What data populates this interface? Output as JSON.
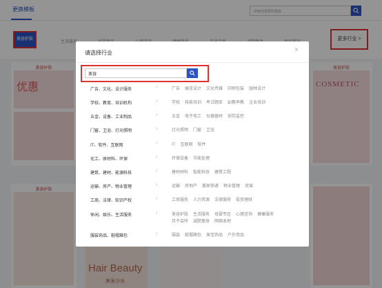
{
  "background": {
    "top_tab": "更换模板",
    "search_placeholder": "搜索您需要的模板",
    "active_category": "美容护肤",
    "ghost_categories": [
      "生活服务",
      "母婴专区",
      "心理咨询",
      "健康服务",
      "月子会所",
      "减肥瘦身",
      "医疗美容"
    ],
    "more_label": "更多行业 >",
    "card_labels": [
      "美容护肤",
      "美容护肤",
      "美容护肤"
    ],
    "cosmetic_text": "COSMETIC",
    "hair_text": "Hair Beauty",
    "hair_sub": "美发沙龙",
    "poster_text": "优惠"
  },
  "modal": {
    "title": "请选择行业",
    "close_icon": "×",
    "search_value": "美容",
    "search_button_icon": "search-icon",
    "rows": [
      {
        "label": "广告、文化、设计服务",
        "tags": [
          "广告",
          "展览设计",
          "文化传媒",
          "印刷包装",
          "园林设计"
        ]
      },
      {
        "label": "学校、教育、培训机构",
        "tags": [
          "学校",
          "技能培训",
          "考试题库",
          "幼教早教",
          "企业培训"
        ]
      },
      {
        "label": "五金、设备、工业制品",
        "tags": [
          "五金",
          "电子电工",
          "仪器器材",
          "安防监控"
        ]
      },
      {
        "label": "门窗、卫浴、灯光照明",
        "tags": [
          "灯光照明",
          "门窗",
          "卫浴"
        ]
      },
      {
        "label": "IT、软件、互联网",
        "tags": [
          "IT",
          "互联网",
          "软件"
        ]
      },
      {
        "label": "化工、原材料、环保",
        "tags": [
          "环保设备",
          "节能处理"
        ]
      },
      {
        "label": "建筑、建材、能源科技",
        "tags": [
          "建材材料",
          "智能科技",
          "建筑工程"
        ]
      },
      {
        "label": "运输、房产、物业管理",
        "tags": [
          "运输",
          "房地产",
          "搬家快递",
          "物业管理",
          "贸易"
        ]
      },
      {
        "label": "工商、法律、知识产权",
        "tags": [
          "工商服务",
          "人力资源",
          "法律服务",
          "投资理财"
        ]
      },
      {
        "label": "休闲、娱乐、生活服务",
        "tags": [
          "美容护肤",
          "生活服务",
          "母婴专区",
          "心理咨询",
          "健康服务",
          "月子会所",
          "减肥瘦身",
          "网络本地"
        ]
      },
      {
        "label": "服装饰品、鞋帽箱包",
        "tags": [
          "服装",
          "鞋帽箱包",
          "珠宝饰品",
          "户外用品"
        ]
      }
    ]
  }
}
